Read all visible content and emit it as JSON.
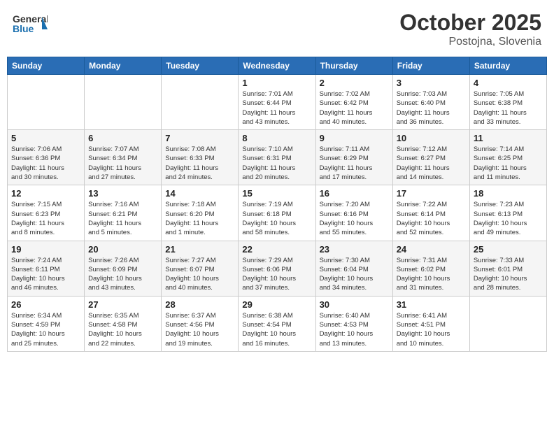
{
  "header": {
    "logo_general": "General",
    "logo_blue": "Blue",
    "month": "October 2025",
    "location": "Postojna, Slovenia"
  },
  "weekdays": [
    "Sunday",
    "Monday",
    "Tuesday",
    "Wednesday",
    "Thursday",
    "Friday",
    "Saturday"
  ],
  "weeks": [
    [
      {
        "day": "",
        "info": ""
      },
      {
        "day": "",
        "info": ""
      },
      {
        "day": "",
        "info": ""
      },
      {
        "day": "1",
        "info": "Sunrise: 7:01 AM\nSunset: 6:44 PM\nDaylight: 11 hours\nand 43 minutes."
      },
      {
        "day": "2",
        "info": "Sunrise: 7:02 AM\nSunset: 6:42 PM\nDaylight: 11 hours\nand 40 minutes."
      },
      {
        "day": "3",
        "info": "Sunrise: 7:03 AM\nSunset: 6:40 PM\nDaylight: 11 hours\nand 36 minutes."
      },
      {
        "day": "4",
        "info": "Sunrise: 7:05 AM\nSunset: 6:38 PM\nDaylight: 11 hours\nand 33 minutes."
      }
    ],
    [
      {
        "day": "5",
        "info": "Sunrise: 7:06 AM\nSunset: 6:36 PM\nDaylight: 11 hours\nand 30 minutes."
      },
      {
        "day": "6",
        "info": "Sunrise: 7:07 AM\nSunset: 6:34 PM\nDaylight: 11 hours\nand 27 minutes."
      },
      {
        "day": "7",
        "info": "Sunrise: 7:08 AM\nSunset: 6:33 PM\nDaylight: 11 hours\nand 24 minutes."
      },
      {
        "day": "8",
        "info": "Sunrise: 7:10 AM\nSunset: 6:31 PM\nDaylight: 11 hours\nand 20 minutes."
      },
      {
        "day": "9",
        "info": "Sunrise: 7:11 AM\nSunset: 6:29 PM\nDaylight: 11 hours\nand 17 minutes."
      },
      {
        "day": "10",
        "info": "Sunrise: 7:12 AM\nSunset: 6:27 PM\nDaylight: 11 hours\nand 14 minutes."
      },
      {
        "day": "11",
        "info": "Sunrise: 7:14 AM\nSunset: 6:25 PM\nDaylight: 11 hours\nand 11 minutes."
      }
    ],
    [
      {
        "day": "12",
        "info": "Sunrise: 7:15 AM\nSunset: 6:23 PM\nDaylight: 11 hours\nand 8 minutes."
      },
      {
        "day": "13",
        "info": "Sunrise: 7:16 AM\nSunset: 6:21 PM\nDaylight: 11 hours\nand 5 minutes."
      },
      {
        "day": "14",
        "info": "Sunrise: 7:18 AM\nSunset: 6:20 PM\nDaylight: 11 hours\nand 1 minute."
      },
      {
        "day": "15",
        "info": "Sunrise: 7:19 AM\nSunset: 6:18 PM\nDaylight: 10 hours\nand 58 minutes."
      },
      {
        "day": "16",
        "info": "Sunrise: 7:20 AM\nSunset: 6:16 PM\nDaylight: 10 hours\nand 55 minutes."
      },
      {
        "day": "17",
        "info": "Sunrise: 7:22 AM\nSunset: 6:14 PM\nDaylight: 10 hours\nand 52 minutes."
      },
      {
        "day": "18",
        "info": "Sunrise: 7:23 AM\nSunset: 6:13 PM\nDaylight: 10 hours\nand 49 minutes."
      }
    ],
    [
      {
        "day": "19",
        "info": "Sunrise: 7:24 AM\nSunset: 6:11 PM\nDaylight: 10 hours\nand 46 minutes."
      },
      {
        "day": "20",
        "info": "Sunrise: 7:26 AM\nSunset: 6:09 PM\nDaylight: 10 hours\nand 43 minutes."
      },
      {
        "day": "21",
        "info": "Sunrise: 7:27 AM\nSunset: 6:07 PM\nDaylight: 10 hours\nand 40 minutes."
      },
      {
        "day": "22",
        "info": "Sunrise: 7:29 AM\nSunset: 6:06 PM\nDaylight: 10 hours\nand 37 minutes."
      },
      {
        "day": "23",
        "info": "Sunrise: 7:30 AM\nSunset: 6:04 PM\nDaylight: 10 hours\nand 34 minutes."
      },
      {
        "day": "24",
        "info": "Sunrise: 7:31 AM\nSunset: 6:02 PM\nDaylight: 10 hours\nand 31 minutes."
      },
      {
        "day": "25",
        "info": "Sunrise: 7:33 AM\nSunset: 6:01 PM\nDaylight: 10 hours\nand 28 minutes."
      }
    ],
    [
      {
        "day": "26",
        "info": "Sunrise: 6:34 AM\nSunset: 4:59 PM\nDaylight: 10 hours\nand 25 minutes."
      },
      {
        "day": "27",
        "info": "Sunrise: 6:35 AM\nSunset: 4:58 PM\nDaylight: 10 hours\nand 22 minutes."
      },
      {
        "day": "28",
        "info": "Sunrise: 6:37 AM\nSunset: 4:56 PM\nDaylight: 10 hours\nand 19 minutes."
      },
      {
        "day": "29",
        "info": "Sunrise: 6:38 AM\nSunset: 4:54 PM\nDaylight: 10 hours\nand 16 minutes."
      },
      {
        "day": "30",
        "info": "Sunrise: 6:40 AM\nSunset: 4:53 PM\nDaylight: 10 hours\nand 13 minutes."
      },
      {
        "day": "31",
        "info": "Sunrise: 6:41 AM\nSunset: 4:51 PM\nDaylight: 10 hours\nand 10 minutes."
      },
      {
        "day": "",
        "info": ""
      }
    ]
  ]
}
